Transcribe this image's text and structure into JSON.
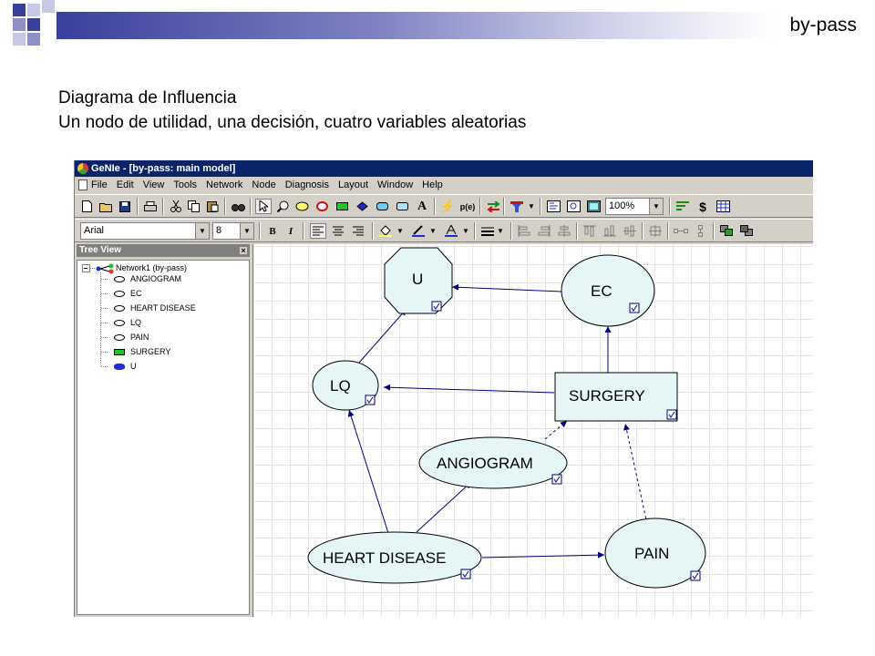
{
  "slide": {
    "tag": "by-pass",
    "title_line1": "Diagrama de Influencia",
    "title_line2": "Un nodo de utilidad, una decisión, cuatro variables aleatorias"
  },
  "window": {
    "title": "GeNIe - [by-pass: main model]",
    "menu": [
      "File",
      "Edit",
      "View",
      "Tools",
      "Network",
      "Node",
      "Diagnosis",
      "Layout",
      "Window",
      "Help"
    ]
  },
  "toolbar": {
    "zoom": "100%",
    "font_name": "Arial",
    "font_size": "8",
    "bold_label": "B",
    "italic_label": "I",
    "text_tool_label": "A",
    "cost_label": "$"
  },
  "tree_view": {
    "header": "Tree View",
    "close_label": "×",
    "root_label": "Network1 (by-pass)",
    "nodes": [
      {
        "label": "ANGIOGRAM",
        "kind": "chance"
      },
      {
        "label": "EC",
        "kind": "chance"
      },
      {
        "label": "HEART DISEASE",
        "kind": "chance"
      },
      {
        "label": "LQ",
        "kind": "chance"
      },
      {
        "label": "PAIN",
        "kind": "chance"
      },
      {
        "label": "SURGERY",
        "kind": "decision"
      },
      {
        "label": "U",
        "kind": "utility"
      }
    ]
  },
  "diagram": {
    "nodes": {
      "u": {
        "label": "U",
        "kind": "utility"
      },
      "ec": {
        "label": "EC",
        "kind": "chance"
      },
      "lq": {
        "label": "LQ",
        "kind": "chance"
      },
      "surgery": {
        "label": "SURGERY",
        "kind": "decision"
      },
      "angiogram": {
        "label": "ANGIOGRAM",
        "kind": "chance"
      },
      "heart_disease": {
        "label": "HEART DISEASE",
        "kind": "chance"
      },
      "pain": {
        "label": "PAIN",
        "kind": "chance"
      }
    }
  },
  "colors": {
    "chance_fill": "#e6f6f7",
    "decision_fill": "#e6f6f7",
    "utility_fill": "#e6f6f7",
    "arc": "#000080",
    "titlebar": "#0a246a",
    "slide_accent": "#3a3f9c"
  },
  "icons": {
    "toolbar1": [
      "new-file-icon",
      "open-folder-icon",
      "save-icon",
      "print-icon",
      "cut-icon",
      "copy-icon",
      "paste-icon",
      "find-icon",
      "select-arrow-icon",
      "zoom-icon",
      "chance-node-icon",
      "deterministic-node-icon",
      "decision-node-icon",
      "utility-node-icon",
      "mau-node-icon",
      "text-icon",
      "update-icon",
      "probability-icon",
      "arc-icon",
      "filter-icon",
      "fit-icon",
      "zoom-window-icon",
      "screen-icon",
      "sort-icon",
      "cost-icon",
      "table-icon"
    ]
  }
}
